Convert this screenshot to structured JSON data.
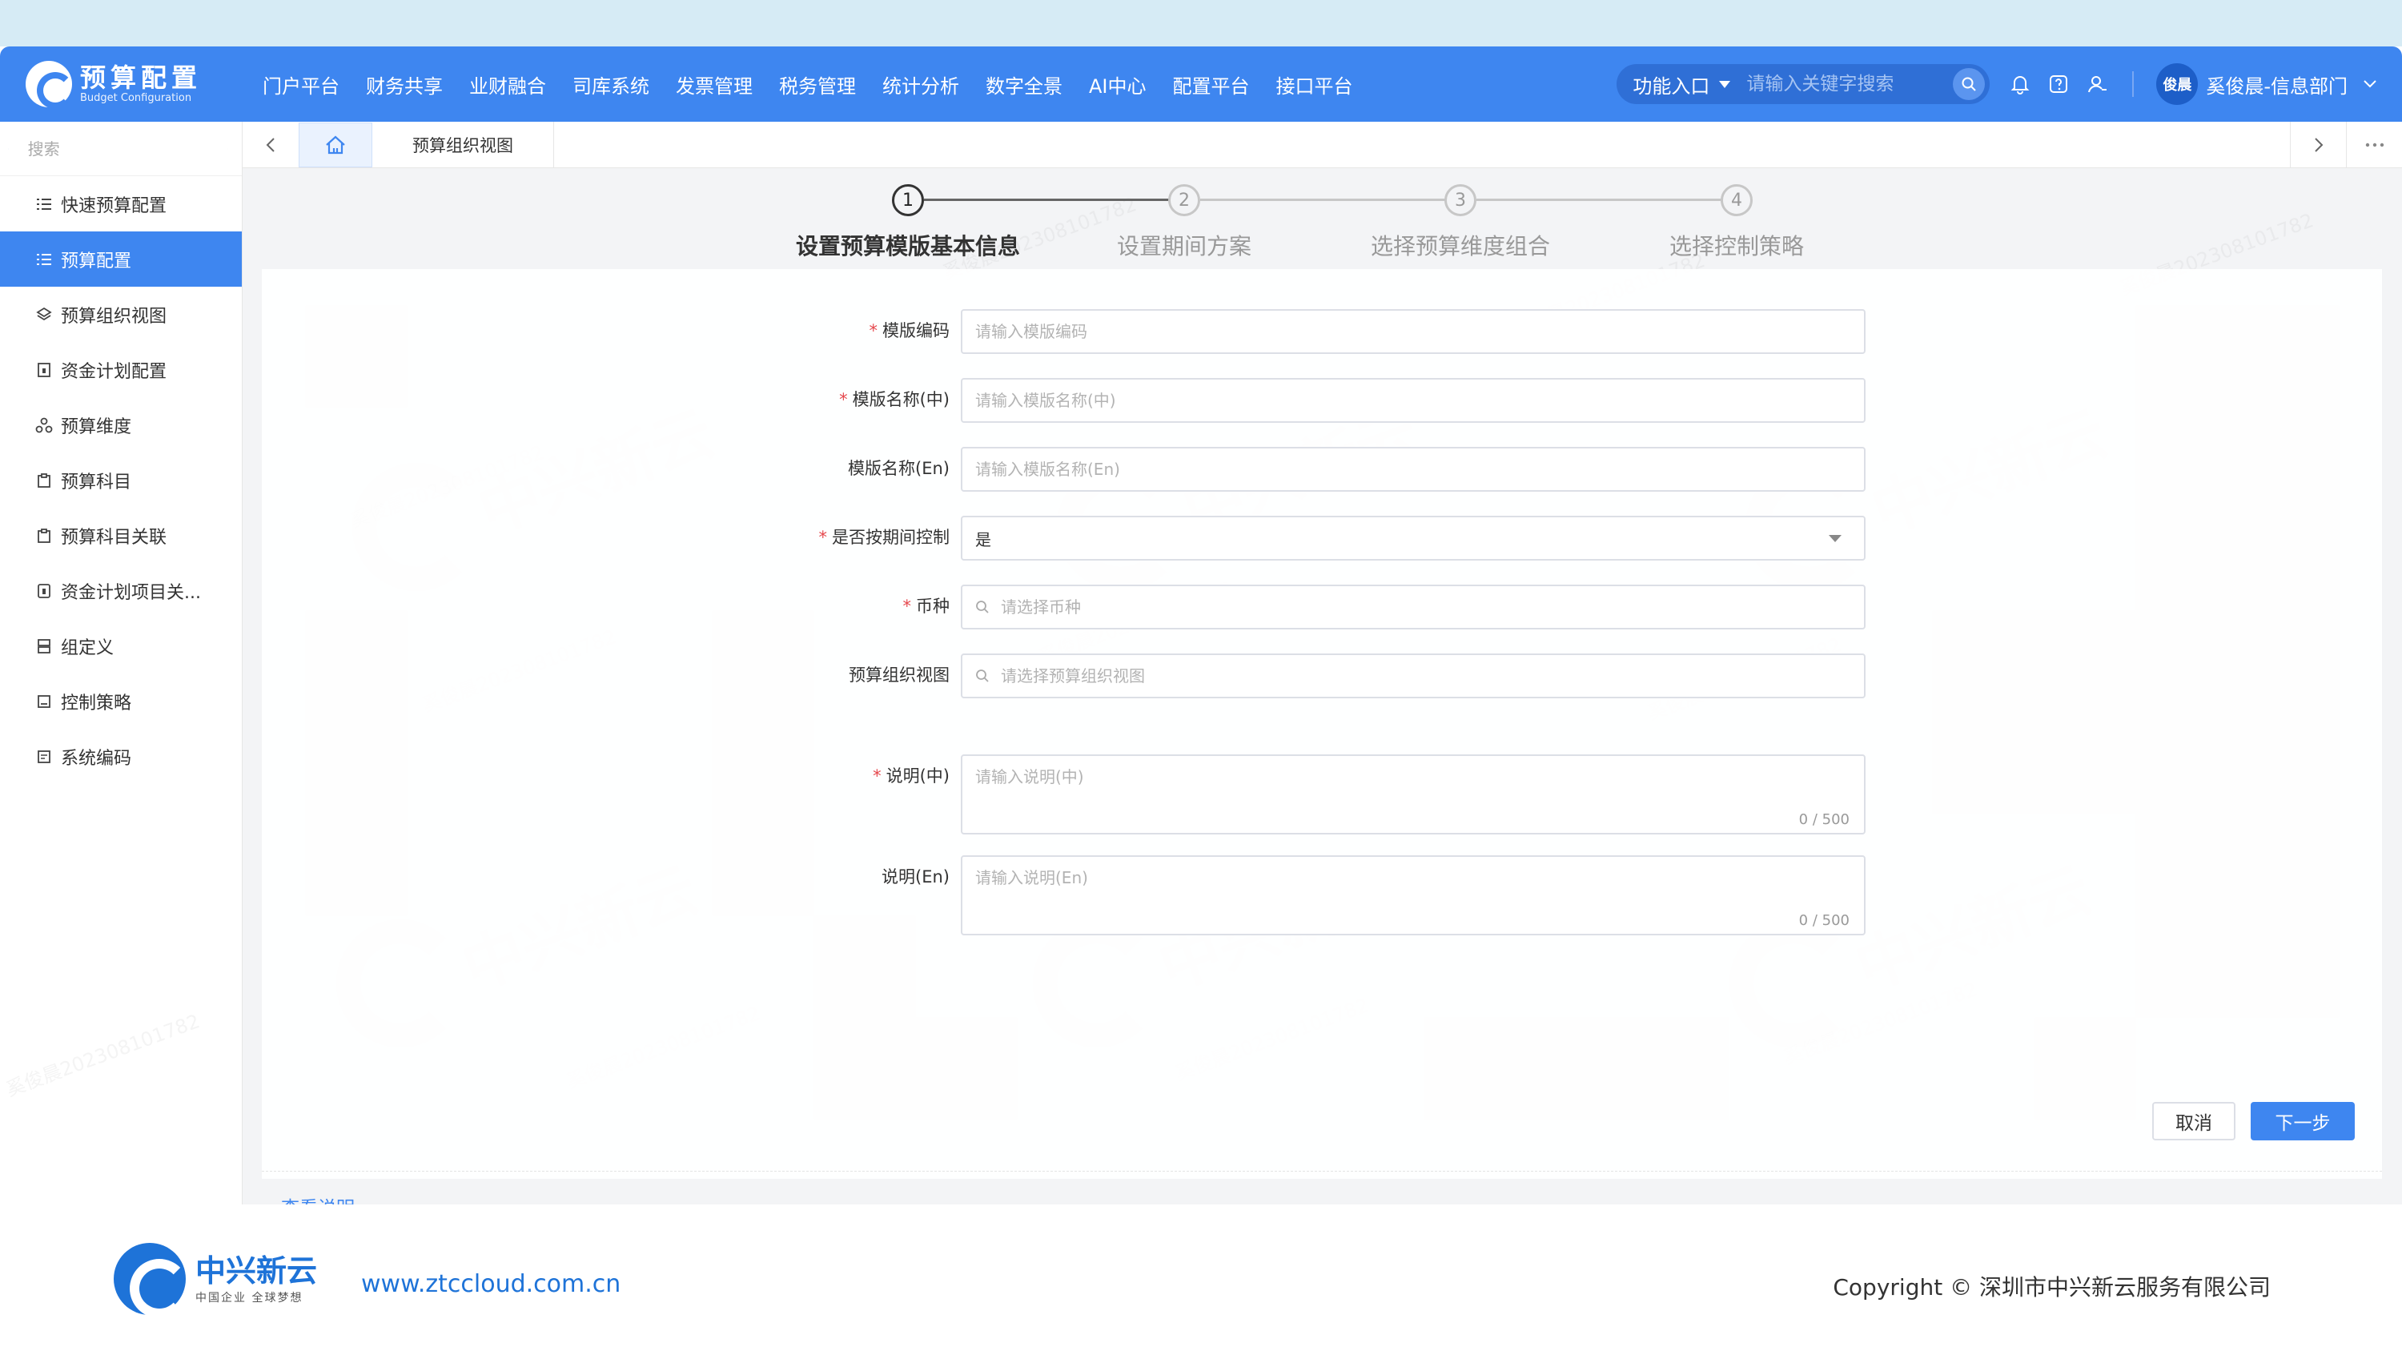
{
  "app": {
    "title": "预算配置",
    "subtitle": "Budget Configuration"
  },
  "nav": {
    "items": [
      {
        "label": "门户平台"
      },
      {
        "label": "财务共享"
      },
      {
        "label": "业财融合"
      },
      {
        "label": "司库系统"
      },
      {
        "label": "发票管理"
      },
      {
        "label": "税务管理"
      },
      {
        "label": "统计分析"
      },
      {
        "label": "数字全景"
      },
      {
        "label": "AI中心"
      },
      {
        "label": "配置平台"
      },
      {
        "label": "接口平台"
      }
    ]
  },
  "header": {
    "func_entry": "功能入口",
    "search_placeholder": "请输入关键字搜索",
    "user_avatar": "俊晨",
    "user_name": "奚俊晨-信息部门"
  },
  "sidebar": {
    "search_placeholder": "搜索",
    "items": [
      {
        "label": "快速预算配置",
        "icon": "list-icon",
        "active": false
      },
      {
        "label": "预算配置",
        "icon": "list-icon",
        "active": true
      },
      {
        "label": "预算组织视图",
        "icon": "layers-icon",
        "active": false
      },
      {
        "label": "资金计划配置",
        "icon": "doc-icon",
        "active": false
      },
      {
        "label": "预算维度",
        "icon": "nodes-icon",
        "active": false
      },
      {
        "label": "预算科目",
        "icon": "clipboard-icon",
        "active": false
      },
      {
        "label": "预算科目关联",
        "icon": "clipboard-icon",
        "active": false
      },
      {
        "label": "资金计划项目关...",
        "icon": "doc-icon",
        "active": false
      },
      {
        "label": "组定义",
        "icon": "group-icon",
        "active": false
      },
      {
        "label": "控制策略",
        "icon": "policy-icon",
        "active": false
      },
      {
        "label": "系统编码",
        "icon": "code-icon",
        "active": false
      }
    ]
  },
  "tabs": {
    "open": "预算组织视图"
  },
  "steps": [
    {
      "num": "1",
      "title": "设置预算模版基本信息",
      "active": true
    },
    {
      "num": "2",
      "title": "设置期间方案",
      "active": false
    },
    {
      "num": "3",
      "title": "选择预算维度组合",
      "active": false
    },
    {
      "num": "4",
      "title": "选择控制策略",
      "active": false
    }
  ],
  "form": {
    "code": {
      "label": "模版编码",
      "required": "*",
      "placeholder": "请输入模版编码"
    },
    "name_cn": {
      "label": "模版名称(中)",
      "required": "*",
      "placeholder": "请输入模版名称(中)"
    },
    "name_en": {
      "label": "模版名称(En)",
      "placeholder": "请输入模版名称(En)"
    },
    "period_ctrl": {
      "label": "是否按期间控制",
      "required": "*",
      "value": "是"
    },
    "currency": {
      "label": "币种",
      "required": "*",
      "placeholder": "请选择币种"
    },
    "org_view": {
      "label": "预算组织视图",
      "placeholder": "请选择预算组织视图"
    },
    "desc_cn": {
      "label": "说明(中)",
      "required": "*",
      "placeholder": "请输入说明(中)",
      "counter": "0 / 500"
    },
    "desc_en": {
      "label": "说明(En)",
      "placeholder": "请输入说明(En)",
      "counter": "0 / 500"
    }
  },
  "actions": {
    "cancel": "取消",
    "next": "下一步",
    "help": "查看说明"
  },
  "watermark": {
    "text": "奚俊晨202308101782",
    "brand": "中兴新云",
    "brand_slogan": "中国企业 全球梦想"
  },
  "footer": {
    "brand": "中兴新云",
    "slogan": "中国企业 全球梦想",
    "url": "www.ztccloud.com.cn",
    "copyright": "Copyright © 深圳市中兴新云服务有限公司"
  },
  "colors": {
    "primary": "#3e86f0",
    "required": "#e5484d",
    "link": "#1e73d8"
  }
}
